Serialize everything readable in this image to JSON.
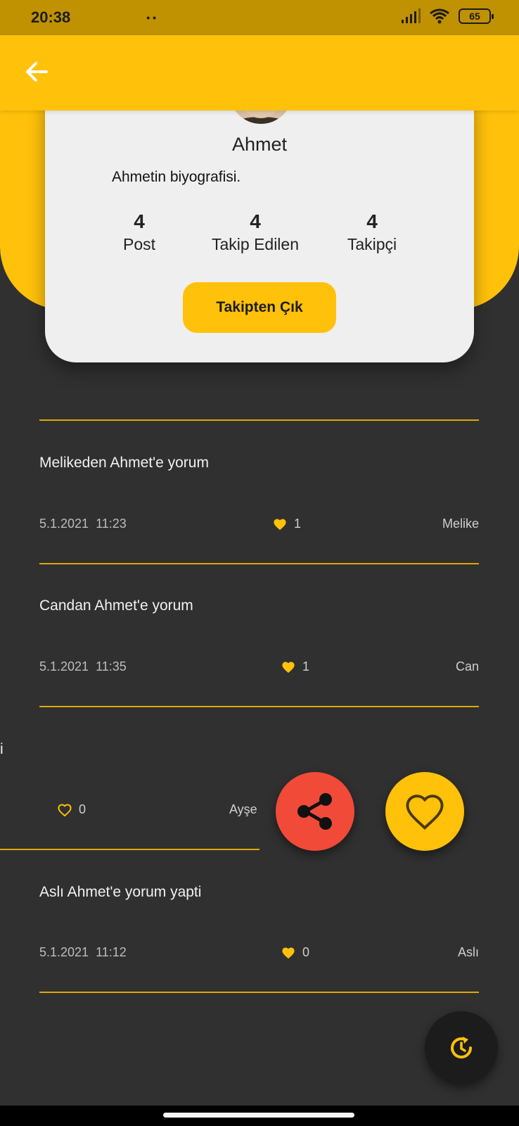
{
  "status_bar": {
    "time": "20:38",
    "dots": "••",
    "battery": "65"
  },
  "profile": {
    "name": "Ahmet",
    "bio": "Ahmetin biyografisi.",
    "stats": [
      {
        "value": "4",
        "label": "Post"
      },
      {
        "value": "4",
        "label": "Takip Edilen"
      },
      {
        "value": "4",
        "label": "Takipçi"
      }
    ],
    "unfollow_label": "Takipten Çık"
  },
  "posts": [
    {
      "title": "Melikeden Ahmet'e yorum",
      "date": "5.1.2021",
      "time": "11:23",
      "likes": "1",
      "author": "Melike",
      "liked": true
    },
    {
      "title": "Candan Ahmet'e yorum",
      "date": "5.1.2021",
      "time": "11:35",
      "likes": "1",
      "author": "Can",
      "liked": true
    },
    {
      "title": "i",
      "likes": "0",
      "author": "Ayşe",
      "liked": false
    },
    {
      "title": "Aslı Ahmet'e yorum yapti",
      "date": "5.1.2021",
      "time": "11:12",
      "likes": "0",
      "author": "Aslı",
      "liked": true
    }
  ],
  "colors": {
    "accent": "#ffc10a",
    "share": "#f14a39",
    "background": "#303030"
  },
  "icons": {
    "back": "arrow-left-icon",
    "share": "share-icon",
    "like": "heart-outline-icon",
    "refresh": "refresh-icon"
  }
}
